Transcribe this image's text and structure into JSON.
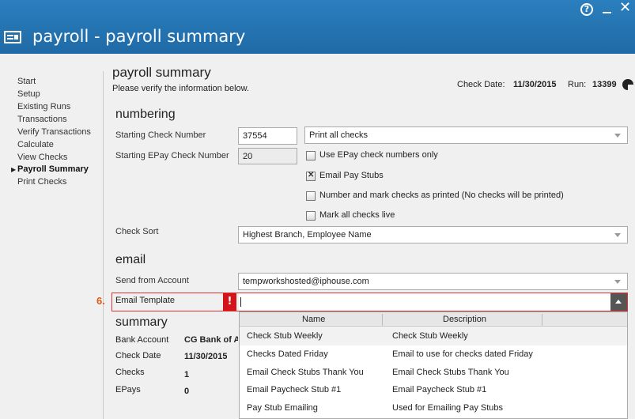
{
  "window": {
    "title": "payroll - payroll summary",
    "help_label": "?",
    "close_label": "✕"
  },
  "sidebar": {
    "items": [
      {
        "label": "Start"
      },
      {
        "label": "Setup"
      },
      {
        "label": "Existing Runs"
      },
      {
        "label": "Transactions"
      },
      {
        "label": "Verify Transactions"
      },
      {
        "label": "Calculate"
      },
      {
        "label": "View Checks"
      },
      {
        "label": "Payroll Summary",
        "active": true
      },
      {
        "label": "Print Checks"
      }
    ],
    "active_marker": "▶"
  },
  "header": {
    "title": "payroll summary",
    "subtitle": "Please verify the information below.",
    "check_date_label": "Check Date:",
    "check_date": "11/30/2015",
    "run_label": "Run:",
    "run": "13399"
  },
  "numbering": {
    "heading": "numbering",
    "starting_check_label": "Starting Check Number",
    "starting_check_value": "37554",
    "print_option": "Print all checks",
    "starting_epay_label": "Starting EPay Check Number",
    "starting_epay_value": "20",
    "options": [
      {
        "label": "Use EPay check numbers only",
        "checked": false
      },
      {
        "label": "Email Pay Stubs",
        "checked": true
      },
      {
        "label": "Number and mark checks as printed (No checks will be printed)",
        "checked": false
      },
      {
        "label": "Mark all checks live",
        "checked": false
      }
    ],
    "check_sort_label": "Check Sort",
    "check_sort_value": "Highest Branch, Employee Name"
  },
  "email": {
    "heading": "email",
    "send_from_label": "Send from Account",
    "send_from_value": "tempworkshosted@iphouse.com",
    "template_label": "Email Template",
    "template_value": "",
    "step_number": "6.",
    "warning": "!"
  },
  "template_dropdown": {
    "columns": [
      "Name",
      "Description"
    ],
    "rows": [
      {
        "name": "Check Stub Weekly",
        "description": "Check Stub Weekly"
      },
      {
        "name": "Checks Dated Friday",
        "description": "Email to use for checks dated Friday"
      },
      {
        "name": "Email Check Stubs Thank You",
        "description": "Email Check Stubs Thank You"
      },
      {
        "name": "Email Paycheck Stub #1",
        "description": "Email Paycheck Stub #1"
      },
      {
        "name": "Pay Stub Emailing",
        "description": "Used for Emailing Pay Stubs"
      }
    ]
  },
  "summary": {
    "heading": "summary",
    "bank_account_label": "Bank Account",
    "bank_account_value": "CG Bank of A",
    "check_date_label": "Check Date",
    "check_date_value": "11/30/2015",
    "checks_label": "Checks",
    "checks_value": "1",
    "epays_label": "EPays",
    "epays_value": "0"
  }
}
